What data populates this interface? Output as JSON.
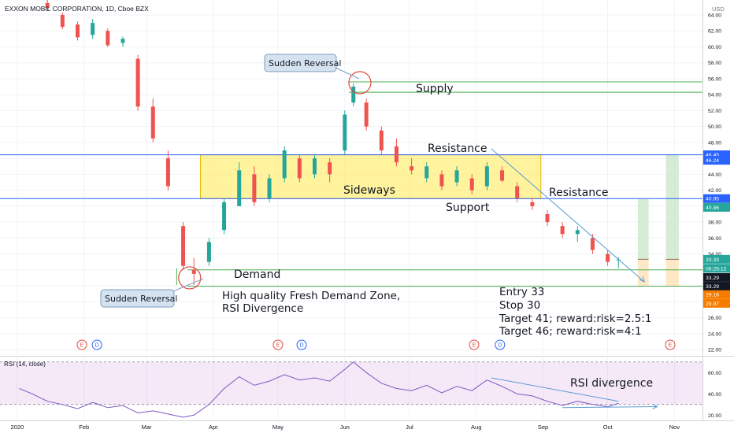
{
  "chart_data": {
    "type": "candlestick",
    "title": "EXXON MOBIL CORPORATION, 1D, Cboe BZX",
    "currency": "USD",
    "x_axis_ticks": [
      "2020",
      "Feb",
      "Mar",
      "Apr",
      "May",
      "Jun",
      "Jul",
      "Aug",
      "Sep",
      "Oct",
      "Nov"
    ],
    "price_axis_ticks": [
      "64.00",
      "62.00",
      "60.00",
      "58.00",
      "56.00",
      "54.00",
      "52.00",
      "50.00",
      "48.00",
      "46.00",
      "44.00",
      "42.00",
      "40.00",
      "38.00",
      "36.00",
      "34.00",
      "32.00",
      "30.00",
      "28.00",
      "26.00",
      "24.00",
      "22.00"
    ],
    "price_range": [
      21.5,
      65.5
    ],
    "price_labels": [
      {
        "text": "46.45",
        "price": 46.45,
        "color": "#2962ff"
      },
      {
        "text": "46.24",
        "price": 45.75,
        "color": "#2962ff"
      },
      {
        "text": "40.95",
        "price": 40.95,
        "color": "#2962ff"
      },
      {
        "text": "40.86",
        "price": 39.85,
        "color": "#26a69a"
      },
      {
        "text": "33.33",
        "price": 33.33,
        "color": "#26a69a"
      },
      {
        "text": "05:25:12",
        "price": 32.2,
        "color": "#26a69a"
      },
      {
        "text": "33.29",
        "price": 31.05,
        "color": "#131722"
      },
      {
        "text": "33.29",
        "price": 29.95,
        "color": "#131722"
      },
      {
        "text": "29.16",
        "price": 28.9,
        "color": "#f57c00"
      },
      {
        "text": "29.97",
        "price": 27.8,
        "color": "#f57c00"
      }
    ],
    "candles_approx": [
      [
        "2020-01-02",
        69.3,
        70.3,
        69.0,
        70.0
      ],
      [
        "2020-01-08",
        68.0,
        68.5,
        66.0,
        66.5
      ],
      [
        "2020-01-15",
        65.5,
        66.0,
        64.5,
        64.9
      ],
      [
        "2020-01-22",
        64.0,
        64.3,
        62.2,
        62.5
      ],
      [
        "2020-01-29",
        62.8,
        63.2,
        60.8,
        61.2
      ],
      [
        "2020-02-05",
        61.5,
        63.5,
        61.0,
        63.0
      ],
      [
        "2020-02-12",
        62.0,
        62.3,
        60.0,
        60.2
      ],
      [
        "2020-02-19",
        60.5,
        61.3,
        60.0,
        61.0
      ],
      [
        "2020-02-26",
        58.5,
        59.0,
        52.0,
        52.5
      ],
      [
        "2020-03-04",
        52.5,
        53.5,
        48.0,
        48.5
      ],
      [
        "2020-03-11",
        46.0,
        47.0,
        42.0,
        42.5
      ],
      [
        "2020-03-18",
        37.5,
        38.0,
        32.0,
        32.5
      ],
      [
        "2020-03-23",
        32.0,
        33.5,
        30.1,
        31.5
      ],
      [
        "2020-03-30",
        33.0,
        36.0,
        32.5,
        35.5
      ],
      [
        "2020-04-06",
        37.0,
        41.0,
        36.5,
        40.5
      ],
      [
        "2020-04-13",
        40.0,
        45.5,
        40.0,
        44.5
      ],
      [
        "2020-04-20",
        44.0,
        45.0,
        40.0,
        40.5
      ],
      [
        "2020-04-27",
        41.0,
        44.0,
        40.5,
        43.5
      ],
      [
        "2020-05-04",
        43.5,
        47.5,
        43.0,
        47.0
      ],
      [
        "2020-05-11",
        46.0,
        46.5,
        43.0,
        43.5
      ],
      [
        "2020-05-18",
        44.0,
        46.5,
        43.5,
        46.0
      ],
      [
        "2020-05-25",
        45.5,
        46.0,
        43.0,
        44.0
      ],
      [
        "2020-06-01",
        47.0,
        52.0,
        46.5,
        51.5
      ],
      [
        "2020-06-05",
        53.0,
        55.4,
        52.5,
        55.0
      ],
      [
        "2020-06-11",
        53.0,
        53.5,
        49.5,
        50.0
      ],
      [
        "2020-06-18",
        49.5,
        50.0,
        46.5,
        47.0
      ],
      [
        "2020-06-25",
        47.5,
        48.5,
        45.0,
        45.5
      ],
      [
        "2020-07-02",
        45.0,
        46.0,
        44.0,
        44.5
      ],
      [
        "2020-07-09",
        43.5,
        45.5,
        43.0,
        45.0
      ],
      [
        "2020-07-16",
        44.0,
        44.5,
        42.0,
        42.5
      ],
      [
        "2020-07-23",
        43.0,
        45.0,
        42.5,
        44.5
      ],
      [
        "2020-07-30",
        43.5,
        44.0,
        41.5,
        42.0
      ],
      [
        "2020-08-06",
        42.5,
        45.5,
        42.0,
        45.0
      ],
      [
        "2020-08-13",
        44.5,
        45.0,
        43.0,
        43.2
      ],
      [
        "2020-08-20",
        42.5,
        43.0,
        40.5,
        41.0
      ],
      [
        "2020-08-27",
        40.5,
        41.0,
        39.5,
        40.0
      ],
      [
        "2020-09-03",
        39.0,
        39.5,
        37.5,
        38.0
      ],
      [
        "2020-09-10",
        37.5,
        38.0,
        36.0,
        36.5
      ],
      [
        "2020-09-17",
        36.5,
        37.5,
        35.5,
        37.0
      ],
      [
        "2020-09-24",
        36.0,
        36.5,
        34.0,
        34.5
      ],
      [
        "2020-10-01",
        34.0,
        34.5,
        32.5,
        33.0
      ],
      [
        "2020-10-06",
        33.2,
        33.6,
        32.2,
        33.3
      ]
    ],
    "horizontal_lines": [
      {
        "price": 46.45,
        "color": "#2962ff"
      },
      {
        "price": 40.95,
        "color": "#2962ff"
      },
      {
        "price": 55.6,
        "color": "#4caf50"
      },
      {
        "price": 54.3,
        "color": "#4caf50"
      },
      {
        "price": 32.0,
        "color": "#4caf50"
      },
      {
        "price": 29.95,
        "color": "#4caf50"
      }
    ],
    "zones": {
      "sideways_box": {
        "start": "2020-03-26",
        "end": "2020-08-31",
        "top": 46.45,
        "bottom": 40.95,
        "color": "#ffe94f"
      },
      "target1_box": {
        "start": "2020-10-15",
        "end": "2020-10-20",
        "top": 40.95,
        "bottom": 33.33,
        "color": "#c8e6c9"
      },
      "target2_box": {
        "start": "2020-10-28",
        "end": "2020-11-03",
        "top": 46.45,
        "bottom": 33.33,
        "color": "#c8e6c9"
      },
      "stop1_box": {
        "start": "2020-10-15",
        "end": "2020-10-20",
        "top": 33.33,
        "bottom": 29.95,
        "color": "#ffe0b2"
      },
      "stop2_box": {
        "start": "2020-10-28",
        "end": "2020-11-03",
        "top": 33.33,
        "bottom": 29.95,
        "color": "#ffe0b2"
      }
    },
    "annotations": {
      "sudden_reversal_top": "Sudden Reversal",
      "sudden_reversal_bottom": "Sudden Reversal",
      "supply": "Supply",
      "resistance_top": "Resistance",
      "resistance_right": "Resistance",
      "sideways": "Sideways",
      "support": "Support",
      "demand": "Demand",
      "demand_note_line1": "High quality Fresh Demand Zone,",
      "demand_note_line2": "RSI Divergence",
      "trade_entry": "Entry 33",
      "trade_stop": "Stop 30",
      "trade_target1": "Target 41; reward:risk=2.5:1",
      "trade_target2": "Target 46; reward:risk=4:1",
      "rsi_divergence": "RSI divergence"
    },
    "events": [
      {
        "date": "2020-01-31",
        "label": "E",
        "color": "#e0483e"
      },
      {
        "date": "2020-02-07",
        "label": "D",
        "color": "#2962ff"
      },
      {
        "date": "2020-05-01",
        "label": "E",
        "color": "#e0483e"
      },
      {
        "date": "2020-05-12",
        "label": "D",
        "color": "#2962ff"
      },
      {
        "date": "2020-07-31",
        "label": "E",
        "color": "#e0483e"
      },
      {
        "date": "2020-08-12",
        "label": "D",
        "color": "#2962ff"
      },
      {
        "date": "2020-10-30",
        "label": "E",
        "color": "#e0483e"
      }
    ],
    "rsi": {
      "label": "RSI (14, close)",
      "ticks": [
        "60.00",
        "40.00",
        "20.00"
      ],
      "range": [
        15,
        75
      ],
      "band": [
        30,
        70
      ],
      "values_approx": [
        [
          "2020-01-02",
          45
        ],
        [
          "2020-01-08",
          40
        ],
        [
          "2020-01-15",
          33
        ],
        [
          "2020-01-22",
          30
        ],
        [
          "2020-01-29",
          26
        ],
        [
          "2020-02-05",
          32
        ],
        [
          "2020-02-12",
          27
        ],
        [
          "2020-02-19",
          29
        ],
        [
          "2020-02-26",
          22
        ],
        [
          "2020-03-04",
          24
        ],
        [
          "2020-03-11",
          21
        ],
        [
          "2020-03-18",
          18
        ],
        [
          "2020-03-23",
          20
        ],
        [
          "2020-03-30",
          30
        ],
        [
          "2020-04-06",
          45
        ],
        [
          "2020-04-13",
          56
        ],
        [
          "2020-04-20",
          48
        ],
        [
          "2020-04-27",
          52
        ],
        [
          "2020-05-04",
          58
        ],
        [
          "2020-05-11",
          53
        ],
        [
          "2020-05-18",
          55
        ],
        [
          "2020-05-25",
          52
        ],
        [
          "2020-06-01",
          63
        ],
        [
          "2020-06-05",
          70
        ],
        [
          "2020-06-11",
          60
        ],
        [
          "2020-06-18",
          50
        ],
        [
          "2020-06-25",
          45
        ],
        [
          "2020-07-02",
          43
        ],
        [
          "2020-07-09",
          48
        ],
        [
          "2020-07-16",
          41
        ],
        [
          "2020-07-23",
          47
        ],
        [
          "2020-07-30",
          43
        ],
        [
          "2020-08-06",
          53
        ],
        [
          "2020-08-13",
          47
        ],
        [
          "2020-08-20",
          40
        ],
        [
          "2020-08-27",
          38
        ],
        [
          "2020-09-03",
          33
        ],
        [
          "2020-09-10",
          29
        ],
        [
          "2020-09-17",
          33
        ],
        [
          "2020-09-24",
          30
        ],
        [
          "2020-10-01",
          28
        ],
        [
          "2020-10-06",
          31
        ]
      ]
    }
  }
}
